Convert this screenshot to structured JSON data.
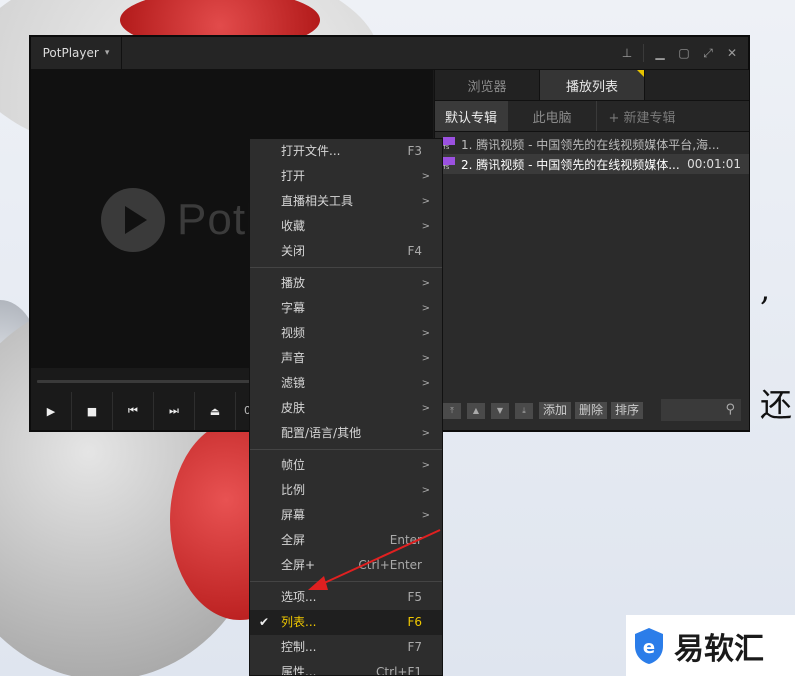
{
  "background": {
    "text_fragments": [
      ",",
      "还"
    ]
  },
  "player": {
    "brand": "PotPlayer",
    "logo_text": "Potl",
    "time_partial": "0"
  },
  "panel": {
    "tabs": [
      {
        "label": "浏览器",
        "active": false
      },
      {
        "label": "播放列表",
        "active": true
      }
    ],
    "subtabs": [
      {
        "label": "默认专辑",
        "active": true
      },
      {
        "label": "此电脑",
        "active": false
      },
      {
        "label": "+ 新建专辑",
        "active": false
      }
    ],
    "playlist": [
      {
        "title": "1. 腾讯视频 - 中国领先的在线视频媒体平台,海...",
        "duration": "",
        "selected": false
      },
      {
        "title": "2. 腾讯视频 - 中国领先的在线视频媒体...",
        "duration": "00:01:01",
        "selected": true
      }
    ],
    "tools": {
      "add": "添加",
      "delete": "删除",
      "sort": "排序"
    }
  },
  "menu": {
    "groups": [
      [
        {
          "label": "打开文件...",
          "shortcut": "F3",
          "submenu": false
        },
        {
          "label": "打开",
          "shortcut": "",
          "submenu": true
        },
        {
          "label": "直播相关工具",
          "shortcut": "",
          "submenu": true
        },
        {
          "label": "收藏",
          "shortcut": "",
          "submenu": true
        },
        {
          "label": "关闭",
          "shortcut": "F4",
          "submenu": false
        }
      ],
      [
        {
          "label": "播放",
          "shortcut": "",
          "submenu": true
        },
        {
          "label": "字幕",
          "shortcut": "",
          "submenu": true
        },
        {
          "label": "视频",
          "shortcut": "",
          "submenu": true
        },
        {
          "label": "声音",
          "shortcut": "",
          "submenu": true
        },
        {
          "label": "滤镜",
          "shortcut": "",
          "submenu": true
        },
        {
          "label": "皮肤",
          "shortcut": "",
          "submenu": true
        },
        {
          "label": "配置/语言/其他",
          "shortcut": "",
          "submenu": true
        }
      ],
      [
        {
          "label": "帧位",
          "shortcut": "",
          "submenu": true
        },
        {
          "label": "比例",
          "shortcut": "",
          "submenu": true
        },
        {
          "label": "屏幕",
          "shortcut": "",
          "submenu": true
        },
        {
          "label": "全屏",
          "shortcut": "Enter",
          "submenu": false
        },
        {
          "label": "全屏+",
          "shortcut": "Ctrl+Enter",
          "submenu": false
        }
      ],
      [
        {
          "label": "选项...",
          "shortcut": "F5",
          "submenu": false
        },
        {
          "label": "列表...",
          "shortcut": "F6",
          "submenu": false,
          "checked": true,
          "active": true
        },
        {
          "label": "控制...",
          "shortcut": "F7",
          "submenu": false
        },
        {
          "label": "属性...",
          "shortcut": "Ctrl+F1",
          "submenu": false
        }
      ]
    ],
    "submenu_glyph": ">",
    "check_glyph": "✔"
  },
  "watermark": {
    "text": "易软汇"
  },
  "colors": {
    "accent_yellow": "#f0c800",
    "playlist_icon": "#9b51e0",
    "arrow": "#e02020",
    "watermark_blue": "#2b7de9"
  }
}
